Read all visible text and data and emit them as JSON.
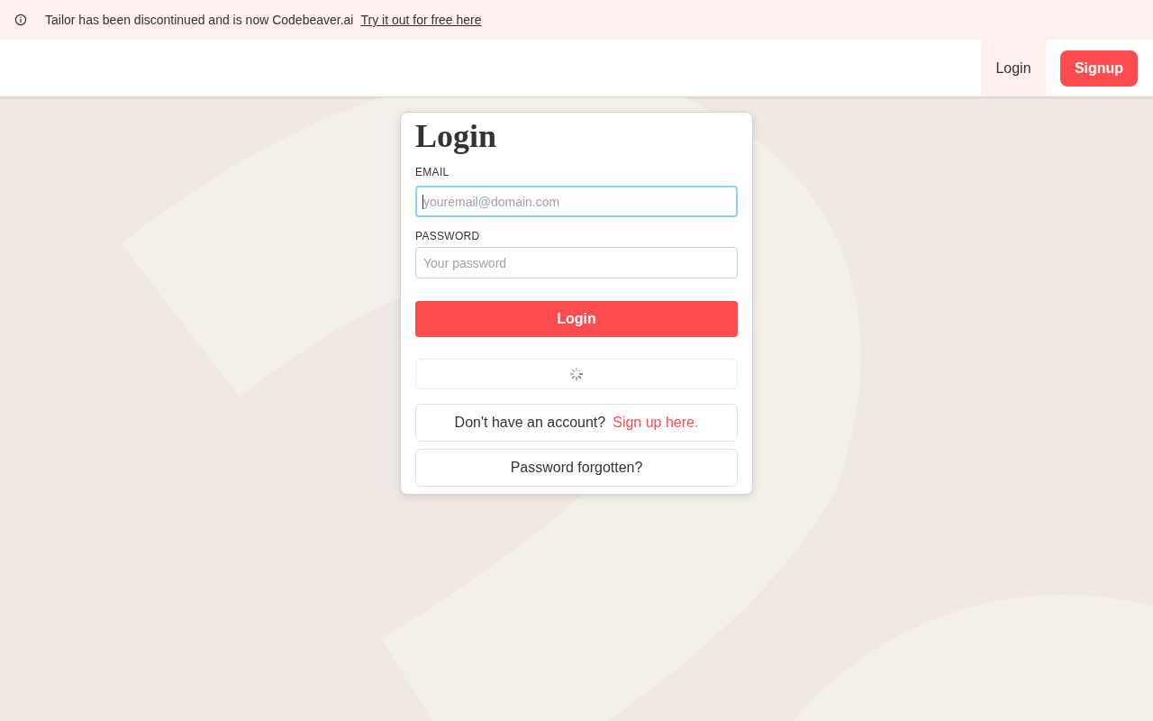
{
  "banner": {
    "message": "Tailor has been discontinued and is now Codebeaver.ai",
    "link": "Try it out for free here"
  },
  "nav": {
    "items": [
      {
        "label": "Login",
        "kind": "link",
        "selected": true
      },
      {
        "label": "Signup",
        "kind": "button",
        "selected": false
      }
    ]
  },
  "login_form": {
    "title": "Login",
    "fields": [
      {
        "label": "EMAIL",
        "placeholder": "youremail@domain.com",
        "focused": true
      },
      {
        "label": "PASSWORD",
        "placeholder": "Your password",
        "focused": false
      }
    ],
    "submit_button": "Login",
    "loading": true,
    "signup_prompt": {
      "text": "Don't have an account?",
      "link": "Sign up here."
    },
    "forgot_password": "Password forgotten?"
  }
}
